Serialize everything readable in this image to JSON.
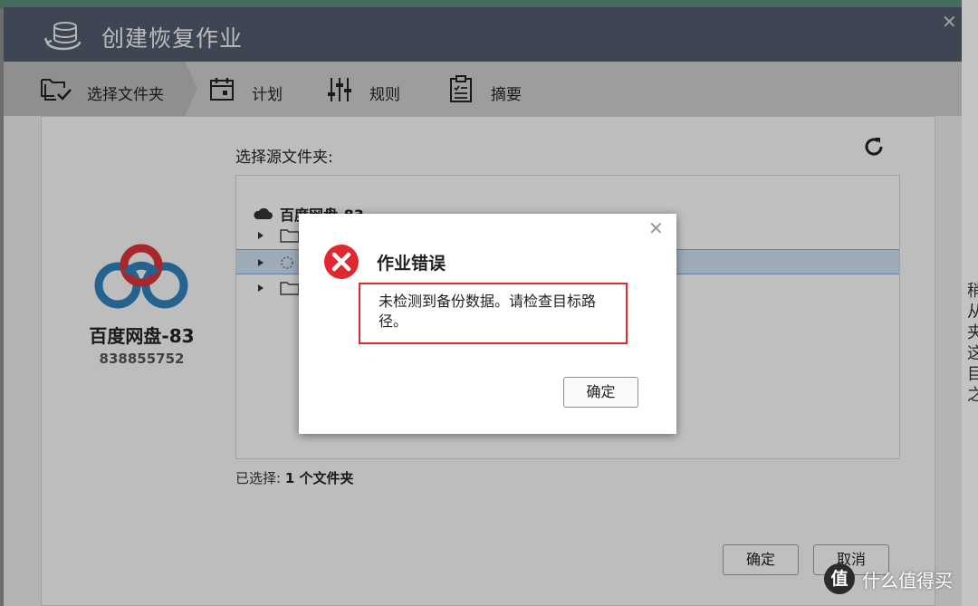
{
  "window": {
    "title": "创建恢复作业",
    "steps": [
      {
        "label": "选择文件夹",
        "icon": "folder-select-icon",
        "active": true
      },
      {
        "label": "计划",
        "icon": "calendar-icon",
        "active": false
      },
      {
        "label": "规则",
        "icon": "sliders-icon",
        "active": false
      },
      {
        "label": "摘要",
        "icon": "clipboard-icon",
        "active": false
      }
    ]
  },
  "account": {
    "name": "百度网盘-83",
    "id": "838855752",
    "logo": "baidu-netdisk-logo"
  },
  "source": {
    "label": "选择源文件夹:",
    "tree_root": "百度网盘-83",
    "selected_prefix": "已选择:",
    "selected_count": "1 个文件夹"
  },
  "buttons": {
    "ok": "确定",
    "cancel": "取消"
  },
  "error_dialog": {
    "title": "作业错误",
    "message": "未检测到备份数据。请检查目标路径。",
    "ok": "确定",
    "icon": "error-x-icon"
  },
  "watermark": {
    "logo_text": "值",
    "text": "什么值得买"
  },
  "background_text": "稍 从 夹 这 目 之",
  "colors": {
    "titlebar": "#505a6b",
    "error_red": "#e0282e",
    "baidu_blue": "#2f7fb8"
  }
}
